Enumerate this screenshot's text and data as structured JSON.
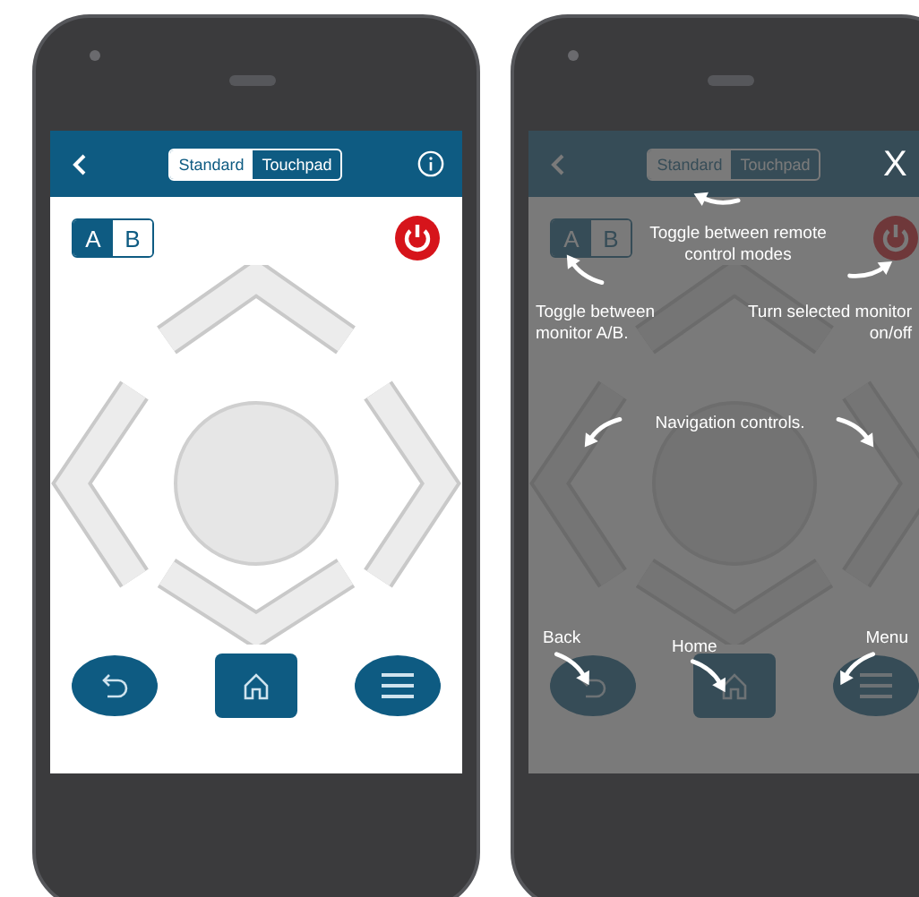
{
  "phones": [
    {
      "kind": "remote",
      "tabs": [
        {
          "label": "Standard",
          "selected": true
        },
        {
          "label": "Touchpad",
          "selected": false
        }
      ],
      "monitors": [
        {
          "label": "A",
          "selected": true
        },
        {
          "label": "B",
          "selected": false
        }
      ]
    },
    {
      "kind": "help",
      "tabs": [
        {
          "label": "Standard",
          "selected": true
        },
        {
          "label": "Touchpad",
          "selected": false
        }
      ],
      "monitors": [
        {
          "label": "A",
          "selected": true
        },
        {
          "label": "B",
          "selected": false
        }
      ],
      "close": "X",
      "callouts": [
        "Toggle between remote control modes",
        "Toggle between monitor A/B.",
        "Turn selected monitor on/off",
        "Navigation controls.",
        "Back",
        "Home",
        "Menu"
      ]
    }
  ]
}
